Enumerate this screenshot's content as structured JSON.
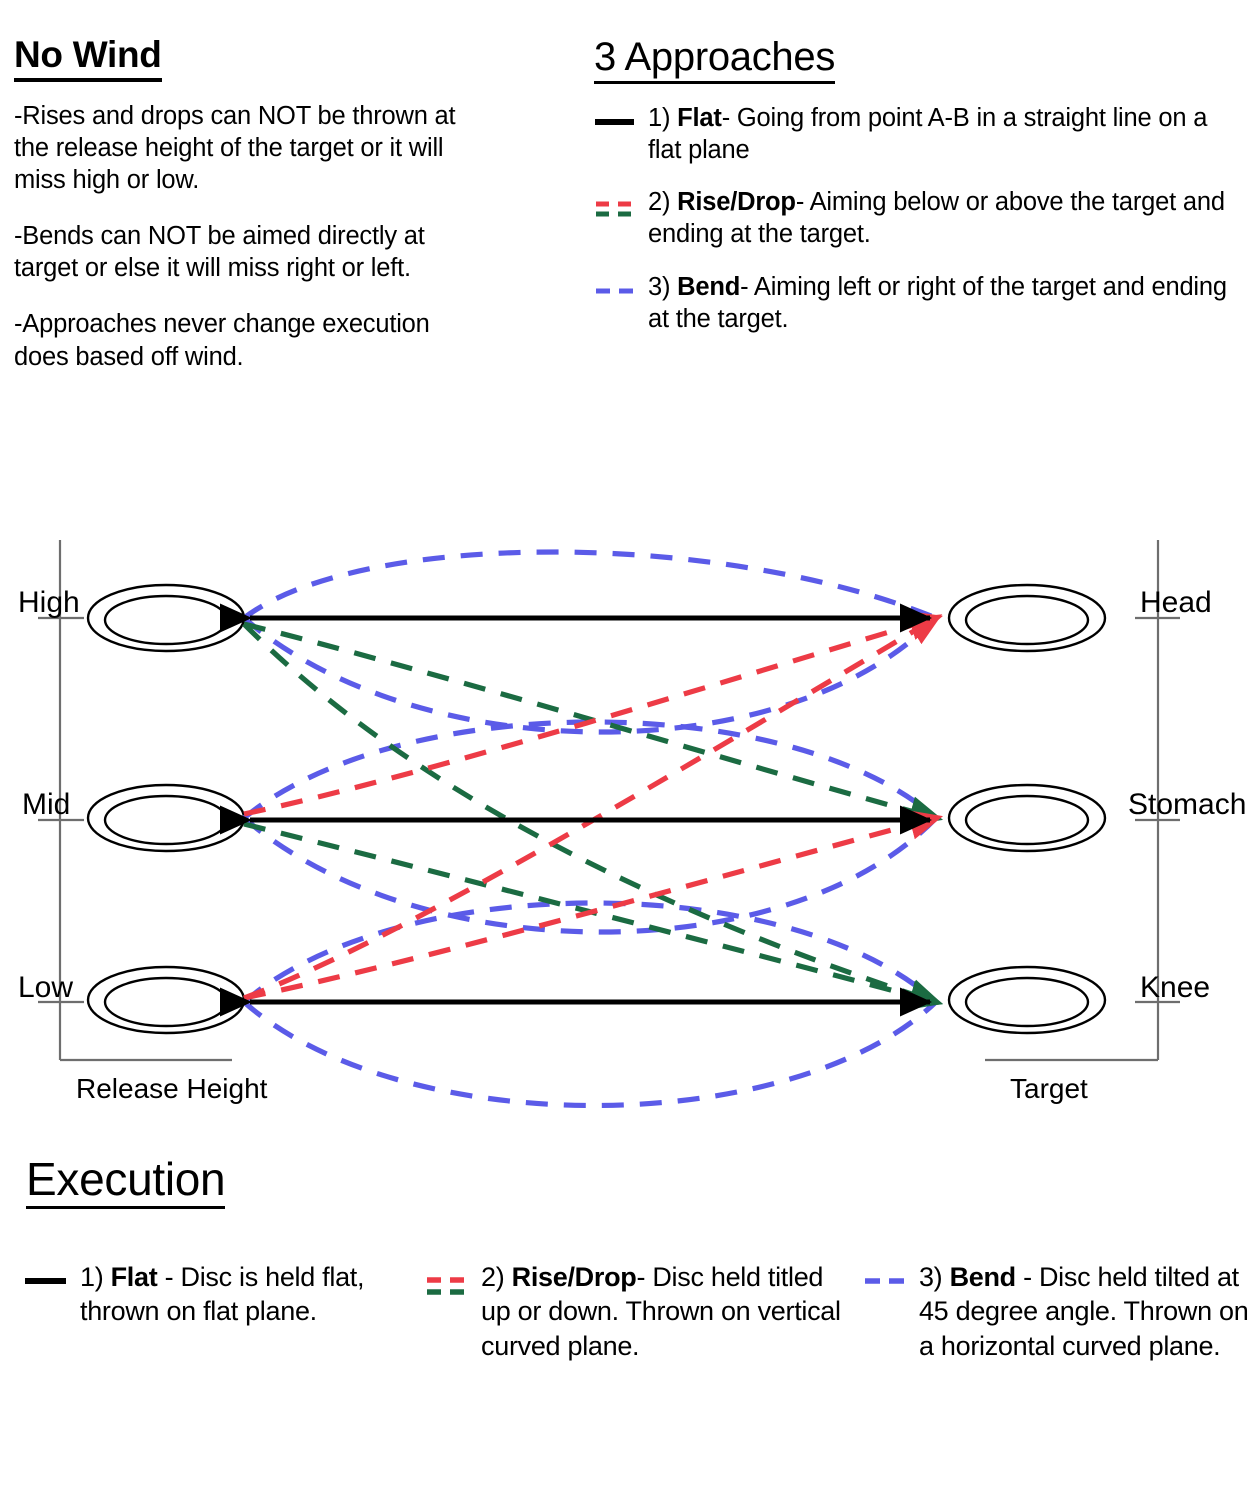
{
  "no_wind": {
    "title": "No Wind",
    "paragraphs": [
      "-Rises and drops can NOT be thrown at the release height of the target or it will miss high or low.",
      "-Bends can NOT be aimed directly at target or else it will miss right or left.",
      "-Approaches never change execution does based off wind."
    ]
  },
  "approaches": {
    "title": "3 Approaches",
    "items": [
      {
        "marker": "solid-black-line-icon",
        "number": "1) ",
        "name": "Flat",
        "desc": "- Going from point A-B in a straight line on a flat plane"
      },
      {
        "marker": "red-green-dashed-line-icon",
        "number": "2) ",
        "name": "Rise/Drop",
        "desc": "- Aiming below or above the target and ending at the target."
      },
      {
        "marker": "blue-dashed-line-icon",
        "number": "3) ",
        "name": "Bend",
        "desc": "- Aiming left or right of the target and ending at the target."
      }
    ]
  },
  "diagram": {
    "left_axis_title": "Release Height",
    "right_axis_title": "Target",
    "left_labels": [
      "High",
      "Mid",
      "Low"
    ],
    "right_labels": [
      "Head",
      "Stomach",
      "Knee"
    ]
  },
  "execution": {
    "title": "Execution",
    "items": [
      {
        "marker": "solid-black-line-icon",
        "number": "1) ",
        "name": "Flat",
        "desc": " - Disc is held flat, thrown on flat plane."
      },
      {
        "marker": "red-green-dashed-line-icon",
        "number": "2) ",
        "name": "Rise/Drop",
        "desc": "- Disc held titled up or down. Thrown on vertical curved plane."
      },
      {
        "marker": "blue-dashed-line-icon",
        "number": "3) ",
        "name": "Bend",
        "desc": " - Disc held tilted at 45 degree angle.  Thrown on a horizontal curved plane."
      }
    ]
  },
  "colors": {
    "flat": "#000000",
    "rise": "#ED3B46",
    "drop": "#1B6B42",
    "bend": "#5B5BE8",
    "axis": "#7A7A7A"
  },
  "chart_data": {
    "type": "line",
    "title": "3 Approaches flight-path diagram",
    "xlabel": "Release Height",
    "ylabel": "Target",
    "x": [
      "Release",
      "Target"
    ],
    "categories": [
      "High / Head",
      "Mid / Stomach",
      "Low / Knee"
    ],
    "grid": false,
    "legend": "top-right",
    "series": [
      {
        "name": "Flat",
        "color": "#000000",
        "style": "solid",
        "paths": [
          "High -> Head",
          "Mid -> Stomach",
          "Low -> Knee"
        ]
      },
      {
        "name": "Rise",
        "color": "#ED3B46",
        "style": "dashed",
        "paths": [
          "Low -> Stomach (rising)",
          "Mid -> Head (rising)",
          "Low -> Head (rising)"
        ]
      },
      {
        "name": "Drop",
        "color": "#1B6B42",
        "style": "dashed",
        "paths": [
          "High -> Stomach (dropping)",
          "Mid -> Knee (dropping)",
          "High -> Knee (dropping)"
        ]
      },
      {
        "name": "Bend",
        "color": "#5B5BE8",
        "style": "dashed",
        "paths": [
          "High -> Head (arc above)",
          "High -> Head (arc below)",
          "Mid -> Stomach (arc above)",
          "Mid -> Stomach (arc below)",
          "Low -> Knee (arc above)",
          "Low -> Knee (arc below)"
        ]
      }
    ]
  }
}
